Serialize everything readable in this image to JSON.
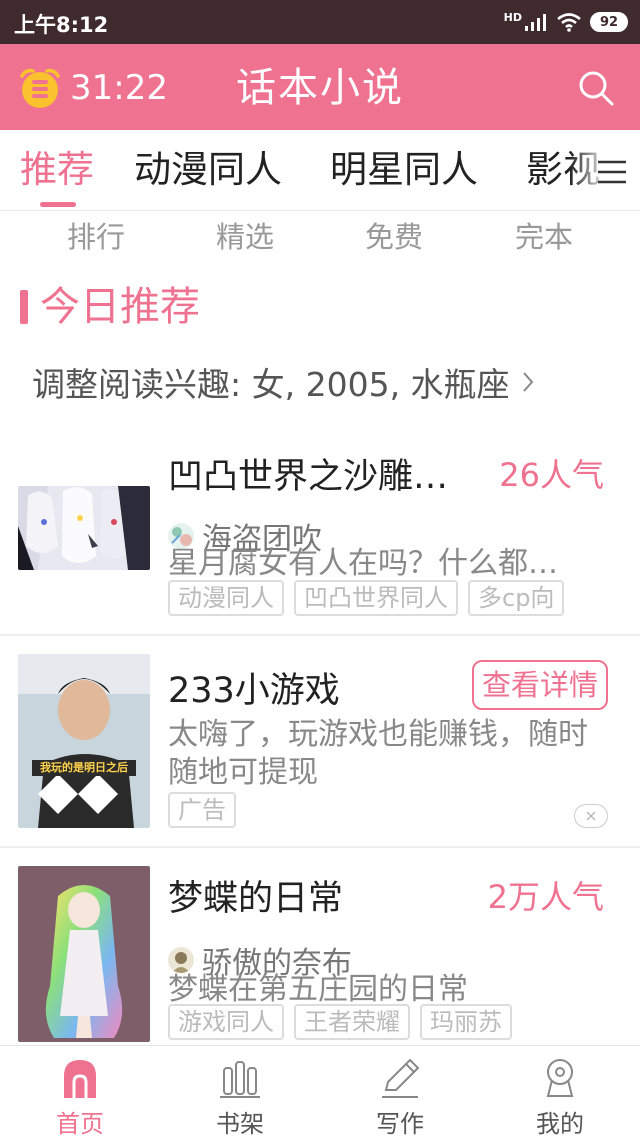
{
  "status_bar": {
    "time": "上午8:12",
    "network": "HD",
    "battery": "92"
  },
  "header": {
    "timer": "31:22",
    "title": "话本小说"
  },
  "tabs": [
    {
      "label": "推荐",
      "active": true
    },
    {
      "label": "动漫同人",
      "active": false
    },
    {
      "label": "明星同人",
      "active": false
    },
    {
      "label": "影视",
      "active": false
    }
  ],
  "subnav": [
    "排行",
    "精选",
    "免费",
    "完本"
  ],
  "section": {
    "title": "今日推荐",
    "interest": "调整阅读兴趣: 女, 2005, 水瓶座"
  },
  "cards": [
    {
      "title": "凹凸世界之沙雕…",
      "popularity": "26人气",
      "author": "海盗团吹",
      "description": "星月腐女有人在吗？什么都…",
      "tags": [
        "动漫同人",
        "凹凸世界同人",
        "多cp向"
      ]
    },
    {
      "title": "233小游戏",
      "button": "查看详情",
      "description": "太嗨了，玩游戏也能赚钱，随时随地可提现",
      "tags": [
        "广告"
      ],
      "cover_caption": "我玩的是明日之后"
    },
    {
      "title": "梦蝶的日常",
      "popularity": "2万人气",
      "author": "骄傲的奈布",
      "description": "梦蝶在第五庄园的日常",
      "tags": [
        "游戏同人",
        "王者荣耀",
        "玛丽苏"
      ]
    }
  ],
  "bottom_nav": [
    {
      "label": "首页",
      "icon": "home-icon",
      "active": true
    },
    {
      "label": "书架",
      "icon": "bookshelf-icon",
      "active": false
    },
    {
      "label": "写作",
      "icon": "pencil-icon",
      "active": false
    },
    {
      "label": "我的",
      "icon": "profile-icon",
      "active": false
    }
  ],
  "colors": {
    "accent": "#ef7290",
    "status_bar": "#3f2a2e",
    "timer_icon": "#f9c22e"
  }
}
